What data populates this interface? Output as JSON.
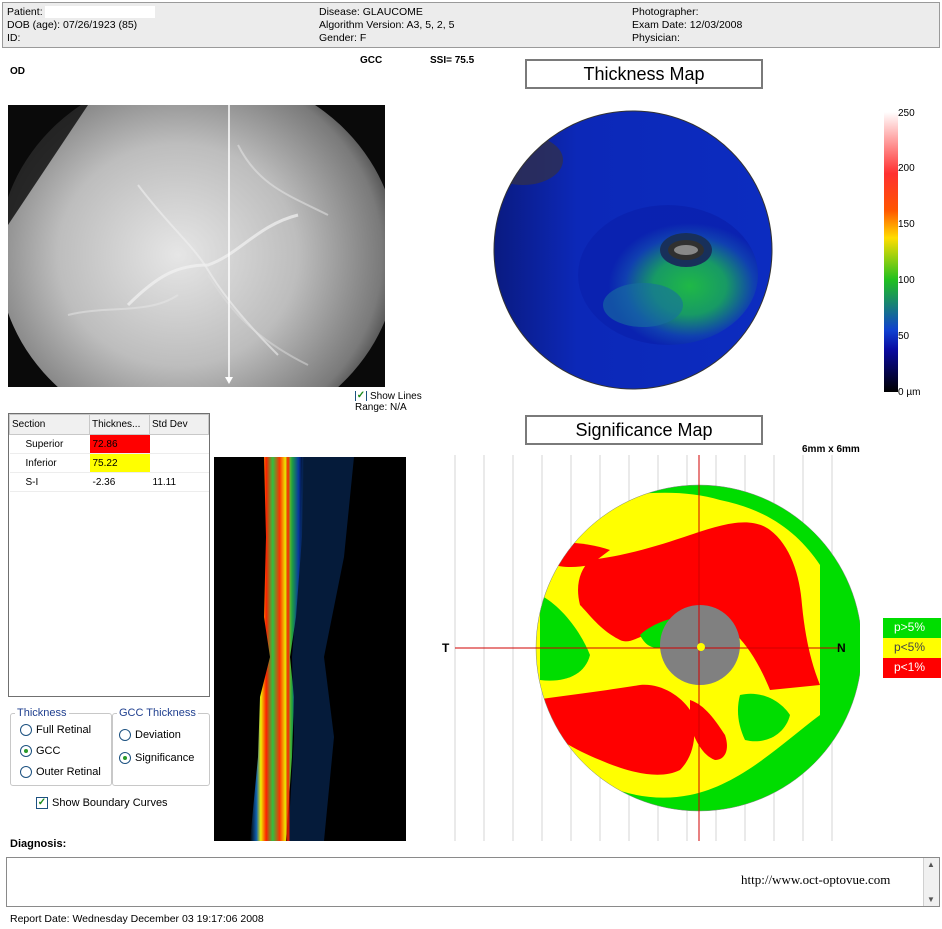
{
  "header": {
    "patient_label": "Patient:",
    "dob": "DOB (age): 07/26/1923 (85)",
    "id_label": "ID:",
    "disease": "Disease: GLAUCOME",
    "algorithm": "Algorithm Version: A3, 5, 2, 5",
    "gender": "Gender: F",
    "photographer": "Photographer:",
    "exam_date": "Exam Date: 12/03/2008",
    "physician": "Physician:"
  },
  "eye": "OD",
  "scan_type": "GCC",
  "ssi": "SSI= 75.5",
  "thickness_map_title": "Thickness Map",
  "significance_map_title": "Significance Map",
  "scan_size": "6mm x 6mm",
  "show_lines_label": "Show Lines",
  "range_label": "Range: N/A",
  "colorbar": {
    "ticks": [
      "250",
      "200",
      "150",
      "100",
      "50",
      "0 µm"
    ],
    "colors": [
      "#ffffff",
      "#ff2020",
      "#ffcc00",
      "#20c020",
      "#0020c0",
      "#000000"
    ]
  },
  "table": {
    "headers": [
      "Section",
      "Thicknes...",
      "Std Dev"
    ],
    "rows": [
      {
        "section": "Superior",
        "thickness": "72.86",
        "std": "",
        "color": "#ff0000"
      },
      {
        "section": "Inferior",
        "thickness": "75.22",
        "std": "",
        "color": "#ffff00"
      },
      {
        "section": "S-I",
        "thickness": "-2.36",
        "std": "11.11",
        "color": ""
      }
    ]
  },
  "thickness_group": {
    "label": "Thickness",
    "options": [
      {
        "label": "Full Retinal",
        "selected": false
      },
      {
        "label": "GCC",
        "selected": true
      },
      {
        "label": "Outer Retinal",
        "selected": false
      }
    ]
  },
  "gcc_group": {
    "label": "GCC Thickness",
    "options": [
      {
        "label": "Deviation",
        "selected": false
      },
      {
        "label": "Significance",
        "selected": true
      }
    ]
  },
  "show_boundary_label": "Show Boundary Curves",
  "map_axes": {
    "temporal": "T",
    "nasal": "N"
  },
  "significance_legend": [
    {
      "label": "p>5%",
      "color": "#00dd00"
    },
    {
      "label": "p<5%",
      "color": "#ffff00"
    },
    {
      "label": "p<1%",
      "color": "#ff0000"
    }
  ],
  "diagnosis_label": "Diagnosis:",
  "diagnosis_url": "http://www.oct-optovue.com",
  "report_date": "Report Date: Wednesday December 03 19:17:06 2008"
}
